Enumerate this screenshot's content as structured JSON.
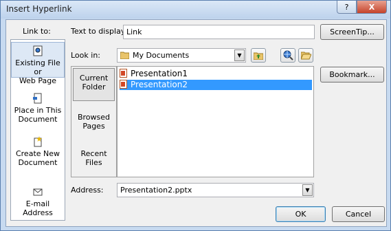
{
  "window": {
    "title": "Insert Hyperlink",
    "help_glyph": "?",
    "close_glyph": "X"
  },
  "sidebar": {
    "header": "Link to:",
    "items": [
      {
        "line1": "Existing File or",
        "line2": "Web Page",
        "icon": "existing-file-icon",
        "selected": true
      },
      {
        "line1": "Place in This",
        "line2": "Document",
        "icon": "place-in-document-icon",
        "selected": false
      },
      {
        "line1": "Create New",
        "line2": "Document",
        "icon": "create-new-document-icon",
        "selected": false
      },
      {
        "line1": "E-mail Address",
        "line2": "",
        "icon": "email-icon",
        "selected": false
      }
    ]
  },
  "text_to_display": {
    "label": "Text to display:",
    "value": "Link"
  },
  "look_in": {
    "label": "Look in:",
    "value": "My Documents"
  },
  "places": [
    {
      "line1": "Current",
      "line2": "Folder",
      "selected": true
    },
    {
      "line1": "Browsed",
      "line2": "Pages",
      "selected": false
    },
    {
      "line1": "Recent",
      "line2": "Files",
      "selected": false
    }
  ],
  "files": [
    {
      "name": "Presentation1",
      "selected": false
    },
    {
      "name": "Presentation2",
      "selected": true
    }
  ],
  "address": {
    "label": "Address:",
    "value": "Presentation2.pptx"
  },
  "buttons": {
    "screentip": "ScreenTip...",
    "bookmark": "Bookmark...",
    "ok": "OK",
    "cancel": "Cancel"
  },
  "colors": {
    "title_bar": "#c7daf0",
    "selection": "#3399ff",
    "close_button": "#c5432b"
  }
}
